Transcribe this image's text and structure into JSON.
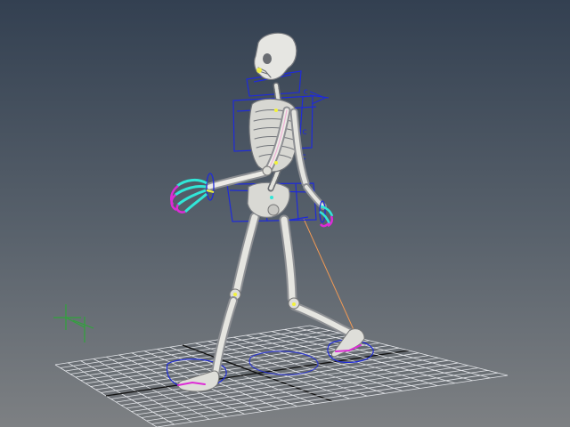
{
  "viewport": {
    "name": "3d-viewport",
    "background_top": "#334051",
    "background_bottom": "#7d8083"
  },
  "colors": {
    "grid": "#e4e6ea",
    "grid_center": "#111111",
    "bone": "#e2e2de",
    "bone_shadow": "#8f9297",
    "control": "#1f2bd8",
    "control_alt": "#2a3ad0",
    "ik_handle": "#f39a54",
    "cyan_joint": "#31e6d7",
    "magenta_joint": "#dd2bd6",
    "yellow_joint": "#f2f23a",
    "axis": "#2fa43a"
  },
  "icons": {
    "axis": "axis-gizmo-icon"
  },
  "rig": {
    "annotation_glyphs": [
      "c",
      "c",
      "c"
    ]
  }
}
